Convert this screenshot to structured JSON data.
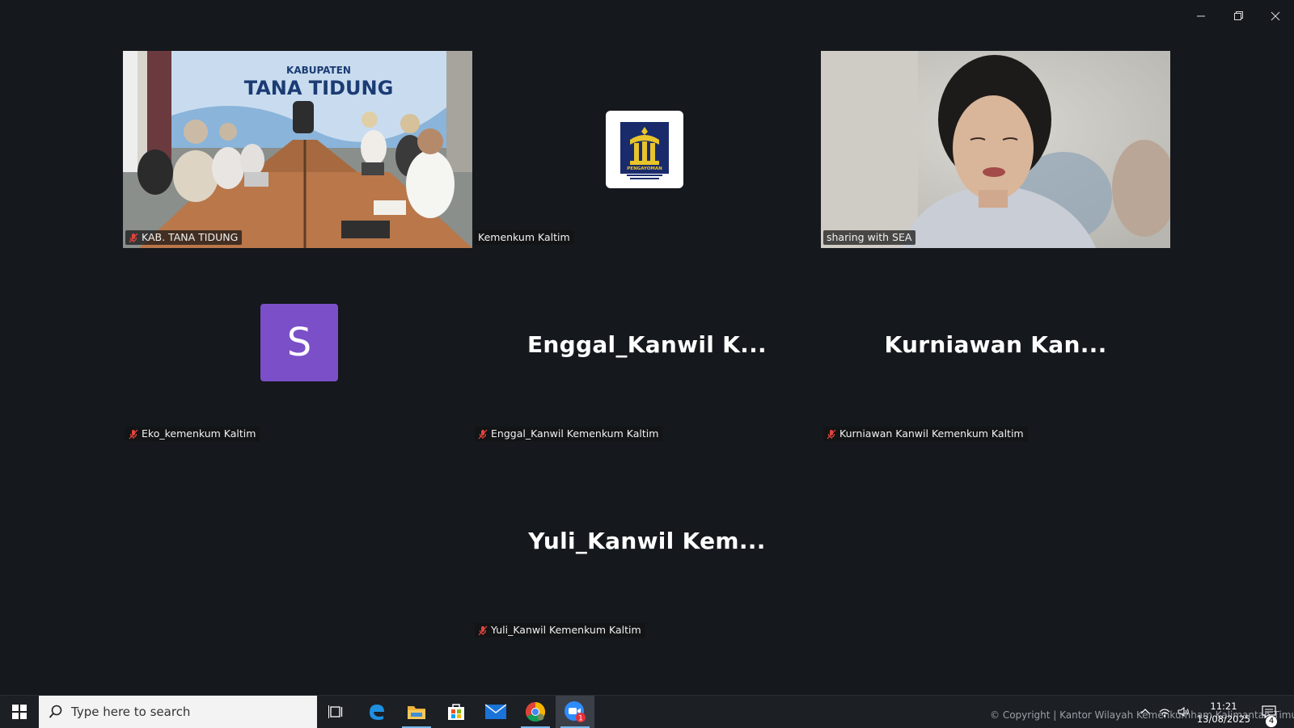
{
  "window": {
    "controls": [
      "minimize",
      "restore",
      "close"
    ]
  },
  "tiles": [
    {
      "id": "tana-tidung",
      "type": "video",
      "name": "KAB. TANA TIDUNG",
      "muted": true,
      "banner_top": "KABUPATEN",
      "banner_main": "TANA TIDUNG"
    },
    {
      "id": "kemenkum",
      "type": "logo",
      "name": "Kemenkum Kaltim",
      "muted": false,
      "logo_text": "PENGAYOMAN"
    },
    {
      "id": "sea",
      "type": "video",
      "name": "sharing with SEA",
      "muted": false,
      "active_speaker": true
    },
    {
      "id": "eko",
      "type": "avatar",
      "name": "Eko_kemenkum Kaltim",
      "muted": true,
      "avatar_letter": "S"
    },
    {
      "id": "enggal",
      "type": "name",
      "name": "Enggal_Kanwil Kemenkum Kaltim",
      "muted": true,
      "display_name": "Enggal_Kanwil  K..."
    },
    {
      "id": "kurniawan",
      "type": "name",
      "name": "Kurniawan Kanwil Kemenkum Kaltim",
      "muted": true,
      "display_name": "Kurniawan  Kan..."
    },
    {
      "id": "yuli",
      "type": "name",
      "name": "Yuli_Kanwil Kemenkum Kaltim",
      "muted": true,
      "display_name": "Yuli_Kanwil  Kem..."
    }
  ],
  "taskbar": {
    "search_placeholder": "Type here to search",
    "apps": [
      "task-view",
      "edge",
      "file-explorer",
      "microsoft-store",
      "mail",
      "chrome",
      "zoom"
    ],
    "zoom_badge": "1",
    "copyright": "© Copyright | Kantor Wilayah Kemenkumham Kalimantan Timur",
    "time": "11:21",
    "date": "13/08/2025",
    "notification_count": "4"
  },
  "colors": {
    "background": "#15181c",
    "active_speaker_border": "#2ec27e",
    "avatar_purple": "#7b4fc8",
    "taskbar": "#1c1f24"
  }
}
